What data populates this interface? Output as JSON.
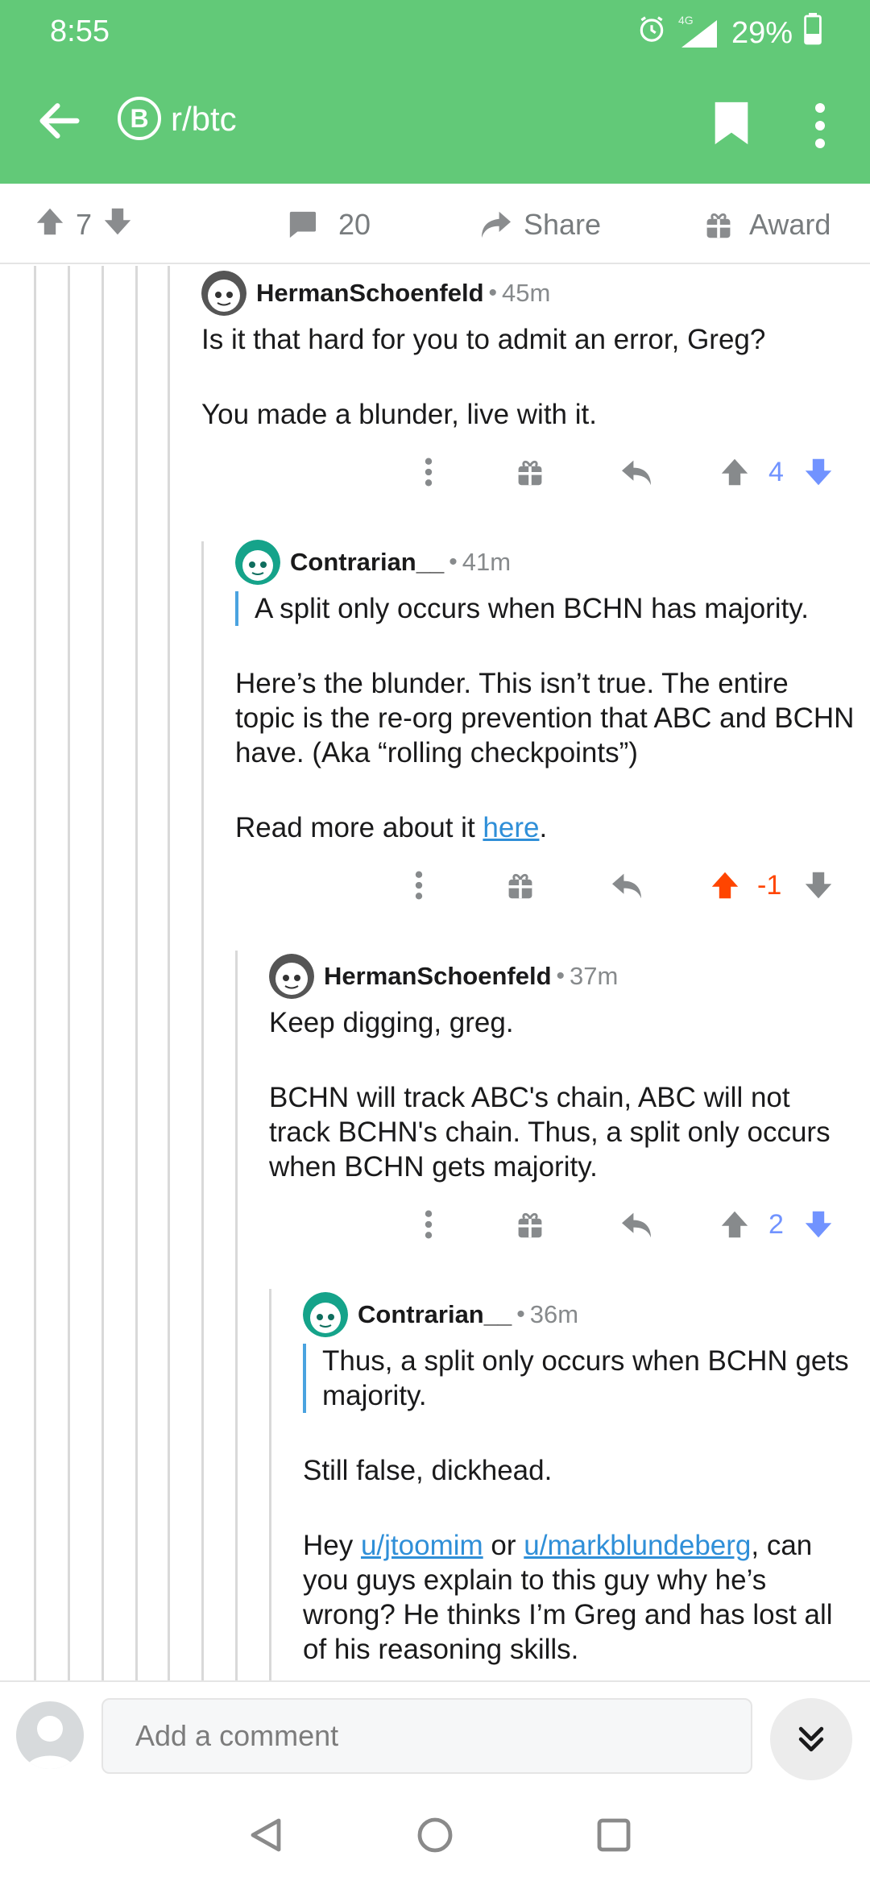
{
  "status_bar": {
    "time": "8:55",
    "network": "4G",
    "battery": "29%"
  },
  "toolbar": {
    "subreddit": "r/btc",
    "sub_icon_glyph": "B"
  },
  "post_actions": {
    "score": "7",
    "comments": "20",
    "share_label": "Share",
    "award_label": "Award"
  },
  "colors": {
    "header": "#62c978",
    "upvoted": "#ff4500",
    "downvoted": "#7193ff",
    "link": "#2f8fd8"
  },
  "comments": [
    {
      "author": "HermanSchoenfeld",
      "time": "45m",
      "paragraphs": [
        "Is it that hard for you to admit an error, Greg?",
        "You made a blunder, live with it."
      ],
      "score": "4",
      "vote": "down"
    },
    {
      "author": "Contrarian__",
      "time": "41m",
      "quote": "A split only occurs when BCHN has majority.",
      "paragraphs": [
        "Here’s the blunder. This isn’t true. The entire topic is the re-org prevention that ABC and BCHN have. (Aka “rolling checkpoints”)"
      ],
      "read_more_prefix": "Read more about it ",
      "read_more_link": "here",
      "read_more_suffix": ".",
      "score": "-1",
      "vote": "up"
    },
    {
      "author": "HermanSchoenfeld",
      "time": "37m",
      "paragraphs": [
        "Keep digging, greg.",
        "BCHN will track ABC's chain, ABC will not track BCHN's chain. Thus, a split only occurs when BCHN gets majority."
      ],
      "score": "2",
      "vote": "down"
    },
    {
      "author": "Contrarian__",
      "time": "36m",
      "quote": "Thus, a split only occurs when BCHN gets majority.",
      "paragraphs": [
        "Still false, dickhead."
      ],
      "hey_prefix": "Hey ",
      "mention1": "u/jtoomim",
      "hey_mid": " or ",
      "mention2": "u/markblundeberg",
      "hey_suffix": ", can you guys explain to this guy why he’s wrong? He thinks I’m Greg and has lost all of his reasoning skills."
    }
  ],
  "composer": {
    "placeholder": "Add a comment"
  }
}
